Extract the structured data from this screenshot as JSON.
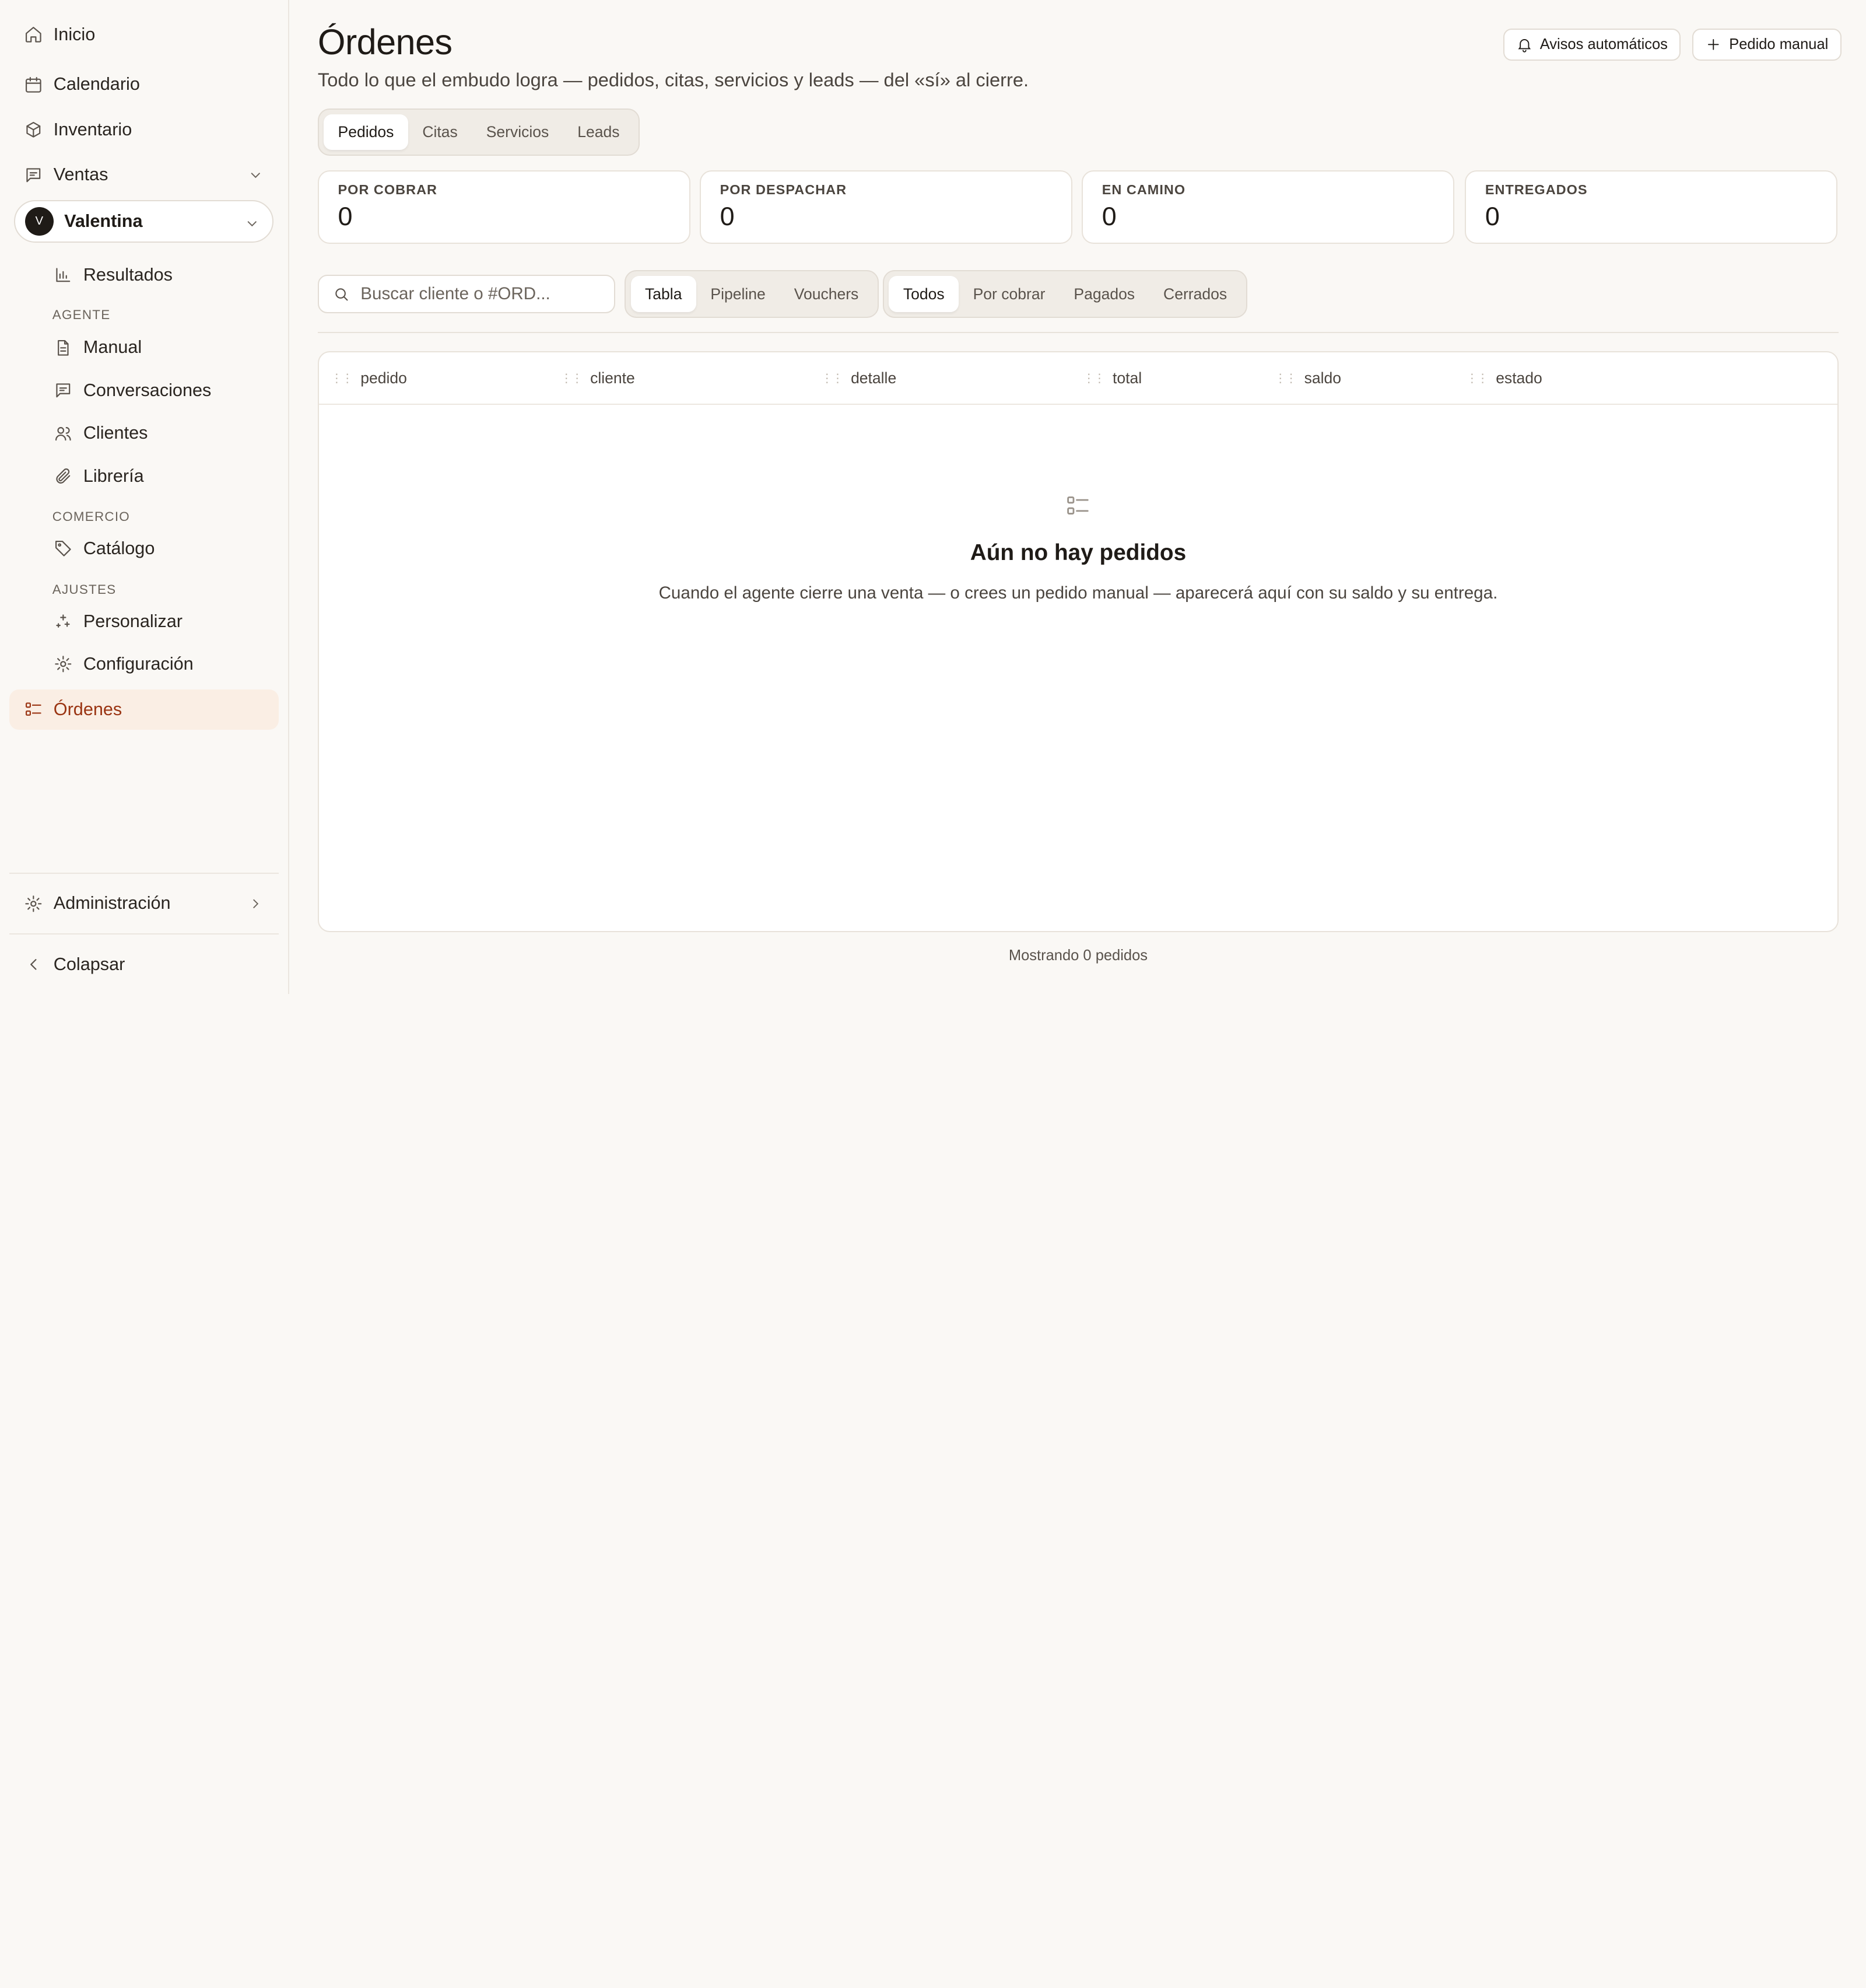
{
  "sidebar": {
    "top_items": [
      {
        "label": "Inicio",
        "icon": "home-icon"
      },
      {
        "label": "Calendario",
        "icon": "calendar-icon"
      },
      {
        "label": "Inventario",
        "icon": "box-icon"
      },
      {
        "label": "Ventas",
        "icon": "message-icon"
      }
    ],
    "account": {
      "initial": "V",
      "name": "Valentina"
    },
    "results_label": "Resultados",
    "sections": {
      "agente": "AGENTE",
      "comercio": "COMERCIO",
      "ajustes": "AJUSTES"
    },
    "agente_items": [
      {
        "label": "Manual",
        "icon": "document-icon"
      },
      {
        "label": "Conversaciones",
        "icon": "chat-icon"
      },
      {
        "label": "Clientes",
        "icon": "users-icon"
      },
      {
        "label": "Librería",
        "icon": "paperclip-icon"
      }
    ],
    "comercio_items": [
      {
        "label": "Catálogo",
        "icon": "tag-icon"
      }
    ],
    "ajustes_items": [
      {
        "label": "Personalizar",
        "icon": "sparkles-icon"
      },
      {
        "label": "Configuración",
        "icon": "gear-icon"
      }
    ],
    "active_item": {
      "label": "Órdenes",
      "icon": "list-icon"
    },
    "admin_label": "Administración",
    "collapse_label": "Colapsar"
  },
  "header": {
    "title": "Órdenes",
    "subtitle": "Todo lo que el embudo logra — pedidos, citas, servicios y leads — del «sí» al cierre.",
    "auto_notices_label": "Avisos automáticos",
    "manual_order_label": "Pedido manual"
  },
  "type_tabs": [
    "Pedidos",
    "Citas",
    "Servicios",
    "Leads"
  ],
  "type_tab_selected": "Pedidos",
  "kpis": [
    {
      "label": "POR COBRAR",
      "value": "0"
    },
    {
      "label": "POR DESPACHAR",
      "value": "0"
    },
    {
      "label": "EN CAMINO",
      "value": "0"
    },
    {
      "label": "ENTREGADOS",
      "value": "0"
    }
  ],
  "search": {
    "placeholder": "Buscar cliente o #ORD..."
  },
  "view_tabs": [
    "Tabla",
    "Pipeline",
    "Vouchers"
  ],
  "view_tab_selected": "Tabla",
  "filter_tabs": [
    "Todos",
    "Por cobrar",
    "Pagados",
    "Cerrados"
  ],
  "filter_tab_selected": "Todos",
  "table": {
    "columns": [
      "pedido",
      "cliente",
      "detalle",
      "total",
      "saldo",
      "estado"
    ],
    "rows": [],
    "empty_title": "Aún no hay pedidos",
    "empty_desc": "Cuando el agente cierre una venta — o crees un pedido manual — aparecerá aquí con su saldo y su entrega."
  },
  "footer": {
    "count_text": "Mostrando 0 pedidos"
  },
  "colors": {
    "accent": "#c2410c",
    "active_bg": "#faeee4",
    "background": "#faf8f5"
  }
}
